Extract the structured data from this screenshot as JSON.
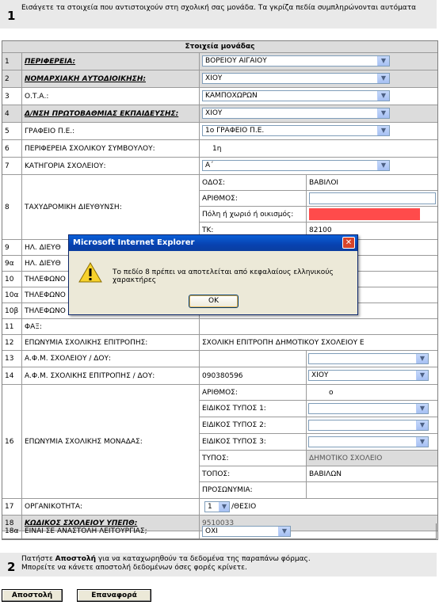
{
  "step1": {
    "number": "1",
    "text": "Εισάγετε τα στοιχεία που αντιστοιχούν στη σχολική σας μονάδα. Τα γκρίζα πεδία συμπληρώνονται αυτόματα"
  },
  "table_title": "Στοιχεία μονάδας",
  "rows": {
    "r1": {
      "num": "1",
      "label": "ΠΕΡΙΦΕΡΕΙΑ:",
      "value": "ΒΟΡΕΙΟΥ ΑΙΓΑΙΟΥ"
    },
    "r2": {
      "num": "2",
      "label": "ΝΟΜΑΡΧΙΑΚΗ ΑΥΤΟΔΙΟΙΚΗΣΗ:",
      "value": "ΧΙΟΥ"
    },
    "r3": {
      "num": "3",
      "label": "Ο.Τ.Α.:",
      "value": "ΚΑΜΠΟΧΩΡΩΝ"
    },
    "r4": {
      "num": "4",
      "label": "Δ/ΝΣΗ ΠΡΩΤΟΒΑΘΜΙΑΣ ΕΚΠΑΙΔΕΥΣΗΣ:",
      "value": "ΧΙΟΥ"
    },
    "r5": {
      "num": "5",
      "label": "ΓΡΑΦΕΙΟ Π.Ε.:",
      "value": "1ο ΓΡΑΦΕΙΟ Π.Ε."
    },
    "r6": {
      "num": "6",
      "label": "ΠΕΡΙΦΕΡΕΙΑ ΣΧΟΛΙΚΟΥ ΣΥΜΒΟΥΛΟΥ:",
      "value": "1η"
    },
    "r7": {
      "num": "7",
      "label": "ΚΑΤΗΓΟΡΙΑ ΣΧΟΛΕΙΟΥ:",
      "value": "Α΄"
    },
    "r8": {
      "num": "8",
      "label": "ΤΑΧΥΔΡΟΜΙΚΗ ΔΙΕΥΘΥΝΣΗ:",
      "sub": [
        {
          "label": "ΟΔΟΣ:",
          "value": "ΒΑΒΙΛΟΙ"
        },
        {
          "label": "ΑΡΙΘΜΟΣ:",
          "value": ""
        },
        {
          "label": "Πόλη ή χωριό ή οικισμός:",
          "value": ""
        },
        {
          "label": "ΤΚ:",
          "value": "82100"
        }
      ]
    },
    "r9": {
      "num": "9",
      "label": "ΗΛ. ΔΙΕΥΘ"
    },
    "r9a": {
      "num": "9α",
      "label": "ΗΛ. ΔΙΕΥΘ"
    },
    "r10": {
      "num": "10",
      "label": "ΤΗΛΕΦΩΝΟ"
    },
    "r10a": {
      "num": "10α",
      "label": "ΤΗΛΕΦΩΝΟ"
    },
    "r10b": {
      "num": "10β",
      "label": "ΤΗΛΕΦΩΝΟ"
    },
    "r11": {
      "num": "11",
      "label": "ΦΑΞ:",
      "value": ""
    },
    "r12": {
      "num": "12",
      "label": "ΕΠΩΝΥΜΙΑ ΣΧΟΛΙΚΗΣ ΕΠΙΤΡΟΠΗΣ:",
      "value": "ΣΧΟΛΙΚΗ ΕΠΙΤΡΟΠΗ ΔΗΜΟΤΙΚΟΥ ΣΧΟΛΕΙΟΥ Ε"
    },
    "r13": {
      "num": "13",
      "label": "Α.Φ.Μ. ΣΧΟΛΕΙΟΥ / ΔΟΥ:",
      "value": "",
      "doy": ""
    },
    "r14": {
      "num": "14",
      "label": "Α.Φ.Μ. ΣΧΟΛΙΚΗΣ ΕΠΙΤΡΟΠΗΣ / ΔΟΥ:",
      "value": "090380596",
      "doy": "ΧΙΟΥ"
    },
    "r16": {
      "num": "16",
      "label": "ΕΠΩΝΥΜΙΑ ΣΧΟΛΙΚΗΣ ΜΟΝΑΔΑΣ:",
      "sub": [
        {
          "label": "ΑΡΙΘΜΟΣ:",
          "value": "ο"
        },
        {
          "label": "ΕΙΔΙΚΟΣ ΤΥΠΟΣ 1:",
          "value": ""
        },
        {
          "label": "ΕΙΔΙΚΟΣ ΤΥΠΟΣ 2:",
          "value": ""
        },
        {
          "label": "ΕΙΔΙΚΟΣ ΤΥΠΟΣ 3:",
          "value": ""
        },
        {
          "label": "ΤΥΠΟΣ:",
          "value": "ΔΗΜΟΤΙΚΟ ΣΧΟΛΕΙΟ"
        },
        {
          "label": "ΤΟΠΟΣ:",
          "value": "ΒΑΒΙΛΩΝ"
        },
        {
          "label": "ΠΡΟΣΩΝΥΜΙΑ:",
          "value": ""
        }
      ]
    },
    "r17": {
      "num": "17",
      "label": "ΟΡΓΑΝΙΚΟΤΗΤΑ:",
      "value": "1",
      "suffix": "/ΘΕΣΙΟ"
    },
    "r18": {
      "num": "18",
      "label": "ΚΩΔΙΚΟΣ ΣΧΟΛΕΙΟΥ ΥΠΕΠΘ:",
      "value": "9510033"
    },
    "r18a": {
      "num": "18α",
      "label": "ΕΙΝΑΙ ΣΕ ΑΝΑΣΤΟΛΗ ΛΕΙΤΟΥΡΓΙΑΣ;",
      "value": "ΟΧΙ"
    }
  },
  "step2": {
    "number": "2",
    "line1_pre": "Πατήστε ",
    "line1_bold": "Αποστολή",
    "line1_post": " για να καταχωρηθούν τα δεδομένα της παραπάνω φόρμας.",
    "line2": "Μπορείτε να κάνετε αποστολή δεδομένων όσες φορές κρίνετε."
  },
  "buttons": {
    "submit": "Αποστολή",
    "reset": "Επαναφορά"
  },
  "dialog": {
    "title": "Microsoft Internet Explorer",
    "message": "Το πεδίο 8 πρέπει να αποτελείται από κεφαλαίους ελληνικούς χαρακτήρες",
    "ok": "OK",
    "icon": "warning-icon"
  },
  "colors": {
    "error_field": "#ff4b4b",
    "dialog_title": "#0842b0"
  }
}
